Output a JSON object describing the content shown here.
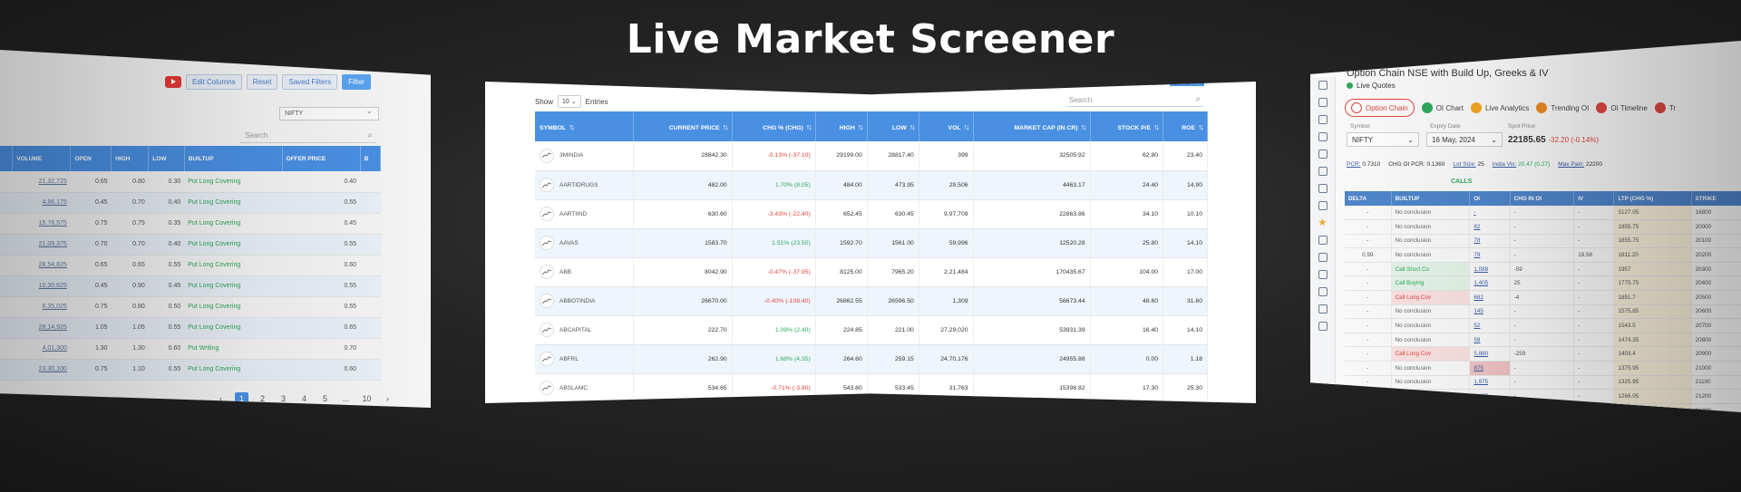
{
  "hero": {
    "title": "Live Market Screener"
  },
  "left": {
    "toolbar": {
      "edit_columns": "Edit Columns",
      "reset": "Reset",
      "saved_filters": "Saved Filters",
      "filter": "Filter"
    },
    "muted_left": "",
    "muted_right": "",
    "select_value": "NIFTY",
    "search_placeholder": "Search",
    "headers": [
      "",
      "VOLUME",
      "OPEN",
      "HIGH",
      "LOW",
      "BUILTUP",
      "OFFER PRICE",
      "B"
    ],
    "rows": [
      [
        "",
        "21,32,725",
        "0.65",
        "0.80",
        "0.30",
        "Put Long Covering",
        "0.40"
      ],
      [
        "",
        "4,86,175",
        "0.45",
        "0.70",
        "0.40",
        "Put Long Covering",
        "0.55"
      ],
      [
        "",
        "15,76,575",
        "0.75",
        "0.75",
        "0.35",
        "Put Long Covering",
        "0.45"
      ],
      [
        "",
        "21,09,375",
        "0.70",
        "0.70",
        "0.40",
        "Put Long Covering",
        "0.55"
      ],
      [
        "",
        "28,54,825",
        "0.65",
        "0.65",
        "0.55",
        "Put Long Covering",
        "0.60"
      ],
      [
        "",
        "10,30,625",
        "0.45",
        "0.90",
        "0.45",
        "Put Long Covering",
        "0.55"
      ],
      [
        "",
        "6,35,025",
        "0.75",
        "0.80",
        "0.50",
        "Put Long Covering",
        "0.55"
      ],
      [
        "",
        "28,14,925",
        "1.05",
        "1.05",
        "0.55",
        "Put Long Covering",
        "0.65"
      ],
      [
        "",
        "4,01,300",
        "1.30",
        "1.30",
        "0.60",
        "Put Writing",
        "0.70"
      ],
      [
        "",
        "23,30,100",
        "0.75",
        "1.10",
        "0.55",
        "Put Long Covering",
        "0.60"
      ]
    ],
    "pager": [
      "1",
      "2",
      "3",
      "4",
      "5",
      "...",
      "10"
    ]
  },
  "center": {
    "show_label": "Show",
    "entries_value": "10",
    "entries_label": "Entries",
    "search_placeholder": "Search",
    "headers": [
      "SYMBOL",
      "CURRENT PRICE",
      "CHG % (CHG)",
      "HIGH",
      "LOW",
      "VOL",
      "MARKET CAP (IN CR)",
      "STOCK P/E",
      "ROE"
    ],
    "rows": [
      {
        "symbol": "3MINDIA",
        "price": "28842.30",
        "chg": "-0.13% (-37.10)",
        "dir": "neg",
        "high": "29199.00",
        "low": "28817.40",
        "vol": "399",
        "mcap": "32505.92",
        "pe": "62.80",
        "roe": "23.40"
      },
      {
        "symbol": "AARTIDRUGS",
        "price": "482.00",
        "chg": "1.70% (8.05)",
        "dir": "pos",
        "high": "484.00",
        "low": "473.95",
        "vol": "29,506",
        "mcap": "4463.17",
        "pe": "24.40",
        "roe": "14.90"
      },
      {
        "symbol": "AARTIIND",
        "price": "630.60",
        "chg": "-3.43% (-22.40)",
        "dir": "neg",
        "high": "652.45",
        "low": "630.45",
        "vol": "9,97,709",
        "mcap": "22863.86",
        "pe": "34.10",
        "roe": "10.10"
      },
      {
        "symbol": "AAVAS",
        "price": "1583.70",
        "chg": "1.51% (23.50)",
        "dir": "pos",
        "high": "1592.70",
        "low": "1561.00",
        "vol": "59,996",
        "mcap": "12520.28",
        "pe": "25.80",
        "roe": "14.10"
      },
      {
        "symbol": "ABB",
        "price": "8042.90",
        "chg": "-0.47% (-37.95)",
        "dir": "neg",
        "high": "8125.00",
        "low": "7965.20",
        "vol": "2,21,484",
        "mcap": "170435.67",
        "pe": "104.00",
        "roe": "17.00"
      },
      {
        "symbol": "ABBOTINDIA",
        "price": "26670.00",
        "chg": "-0.40% (-108.40)",
        "dir": "neg",
        "high": "26862.55",
        "low": "26596.50",
        "vol": "1,309",
        "mcap": "56673.44",
        "pe": "48.60",
        "roe": "31.60"
      },
      {
        "symbol": "ABCAPITAL",
        "price": "222.70",
        "chg": "1.09% (2.40)",
        "dir": "pos",
        "high": "224.85",
        "low": "221.00",
        "vol": "27,29,020",
        "mcap": "53931.39",
        "pe": "16.40",
        "roe": "14.10"
      },
      {
        "symbol": "ABFRL",
        "price": "262.90",
        "chg": "1.68% (4.35)",
        "dir": "pos",
        "high": "264.60",
        "low": "259.15",
        "vol": "24,70,176",
        "mcap": "24955.88",
        "pe": "0.00",
        "roe": "1.18"
      },
      {
        "symbol": "ABSLAMC",
        "price": "534.65",
        "chg": "-0.71% (-3.80)",
        "dir": "neg",
        "high": "543.80",
        "low": "533.45",
        "vol": "31,763",
        "mcap": "15398.82",
        "pe": "17.30",
        "roe": "25.30"
      }
    ]
  },
  "right": {
    "title": "Option Chain NSE with Build Up, Greeks & IV",
    "live_quotes": "Live Quotes",
    "tabs": [
      {
        "label": "Option Chain",
        "color": "#e0463f"
      },
      {
        "label": "OI Chart",
        "color": "#2eaa5c"
      },
      {
        "label": "Live Analytics",
        "color": "#f5a623"
      },
      {
        "label": "Trending OI",
        "color": "#f08a24"
      },
      {
        "label": "OI Timeline",
        "color": "#e0463f"
      },
      {
        "label": "Tr",
        "color": "#e0463f"
      }
    ],
    "symbol_label": "Symbol",
    "symbol_value": "NIFTY",
    "expiry_label": "Expiry Date",
    "expiry_value": "16 May, 2024",
    "spot_label": "Spot Price",
    "spot_value": "22185.65",
    "spot_change": "-32.20 (-0.14%)",
    "stats": {
      "pcr_label": "PCR:",
      "pcr_value": "0.7310",
      "chg_pcr_label": "CHG OI PCR:",
      "chg_pcr_value": "0.1360",
      "lot_label": "Lot Size:",
      "lot_value": "25",
      "india_vix_label": "India Vix:",
      "india_vix_value": "20.47 (0.27)",
      "max_pain_label": "Max Pain:",
      "max_pain_value": "22200"
    },
    "calls_label": "CALLS",
    "headers": [
      "DELTA",
      "BUILTUP",
      "OI",
      "CHG IN OI",
      "IV",
      "LTP (CHG %)",
      "STRIKE"
    ],
    "rows": [
      {
        "delta": "-",
        "builtup": "No conclusion",
        "kind": "none",
        "oi": "-",
        "chg": "-",
        "iv": "-",
        "ltp": "5127.05",
        "strike": "16800"
      },
      {
        "delta": "-",
        "builtup": "No conclusion",
        "kind": "none",
        "oi": "82",
        "chg": "-",
        "iv": "-",
        "ltp": "1855.75",
        "strike": "20000"
      },
      {
        "delta": "-",
        "builtup": "No conclusion",
        "kind": "none",
        "oi": "78",
        "chg": "-",
        "iv": "-",
        "ltp": "1855.75",
        "strike": "20100"
      },
      {
        "delta": "0.99",
        "builtup": "No conclusion",
        "kind": "none",
        "oi": "79",
        "chg": "-",
        "iv": "19.56",
        "ltp": "1811.20",
        "strike": "20200"
      },
      {
        "delta": "-",
        "builtup": "Call Short Co",
        "kind": "green",
        "oi": "1,088",
        "chg": "-59",
        "iv": "-",
        "ltp": "1957",
        "strike": "20300"
      },
      {
        "delta": "-",
        "builtup": "Call Buying",
        "kind": "green",
        "oi": "1,405",
        "chg": "25",
        "iv": "-",
        "ltp": "1775.75",
        "strike": "20400"
      },
      {
        "delta": "-",
        "builtup": "Call Long Cov",
        "kind": "red",
        "oi": "682",
        "chg": "-4",
        "iv": "-",
        "ltp": "1851.7",
        "strike": "20500"
      },
      {
        "delta": "-",
        "builtup": "No conclusion",
        "kind": "none",
        "oi": "145",
        "chg": "-",
        "iv": "-",
        "ltp": "1575.85",
        "strike": "20600"
      },
      {
        "delta": "-",
        "builtup": "No conclusion",
        "kind": "none",
        "oi": "52",
        "chg": "-",
        "iv": "-",
        "ltp": "1543.5",
        "strike": "20700"
      },
      {
        "delta": "-",
        "builtup": "No conclusion",
        "kind": "none",
        "oi": "59",
        "chg": "-",
        "iv": "-",
        "ltp": "1474.35",
        "strike": "20800"
      },
      {
        "delta": "-",
        "builtup": "Call Long Cov",
        "kind": "red",
        "oi": "5,880",
        "chg": "-259",
        "iv": "-",
        "ltp": "1403.4",
        "strike": "20900"
      },
      {
        "delta": "-",
        "builtup": "No conclusion",
        "kind": "none",
        "oi": "875",
        "chg": "-",
        "iv": "-",
        "ltp": "1375.95",
        "strike": "21000"
      },
      {
        "delta": "-",
        "builtup": "No conclusion",
        "kind": "none",
        "oi": "1,975",
        "chg": "-",
        "iv": "-",
        "ltp": "1325.95",
        "strike": "21100"
      },
      {
        "delta": "-",
        "builtup": "No conclusion",
        "kind": "none",
        "oi": "6,425",
        "chg": "-",
        "iv": "-",
        "ltp": "1266.05",
        "strike": "21200"
      },
      {
        "delta": "-",
        "builtup": "",
        "kind": "none",
        "oi": "34",
        "chg": "-4",
        "iv": "-",
        "ltp": "1209",
        "strike": "21300"
      }
    ]
  }
}
